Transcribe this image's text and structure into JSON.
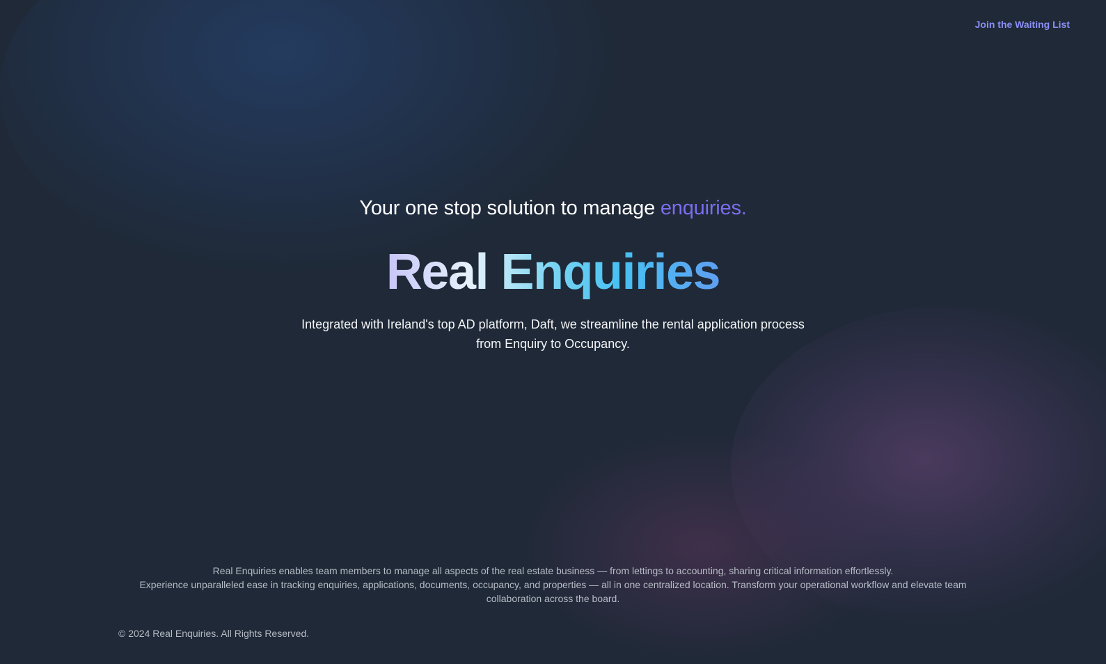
{
  "nav": {
    "waitlist_link": "Join the Waiting List"
  },
  "hero": {
    "tagline_prefix": "Your one stop solution to manage ",
    "tagline_accent": "enquiries.",
    "brand_title": "Real Enquiries",
    "description": "Integrated with Ireland's top AD platform, Daft, we streamline the rental application process from Enquiry to Occupancy."
  },
  "footer": {
    "line1": "Real Enquiries enables team members to manage all aspects of the real estate business — from lettings to accounting, sharing critical information effortlessly.",
    "line2": "Experience unparalleled ease in tracking enquiries, applications, documents, occupancy, and properties — all in one centralized location. Transform your operational workflow and elevate team collaboration across the board.",
    "copyright": "© 2024 Real Enquiries. All Rights Reserved."
  },
  "colors": {
    "background": "#1f2937",
    "accent": "#7c6df0",
    "link": "#8b8ff5"
  }
}
